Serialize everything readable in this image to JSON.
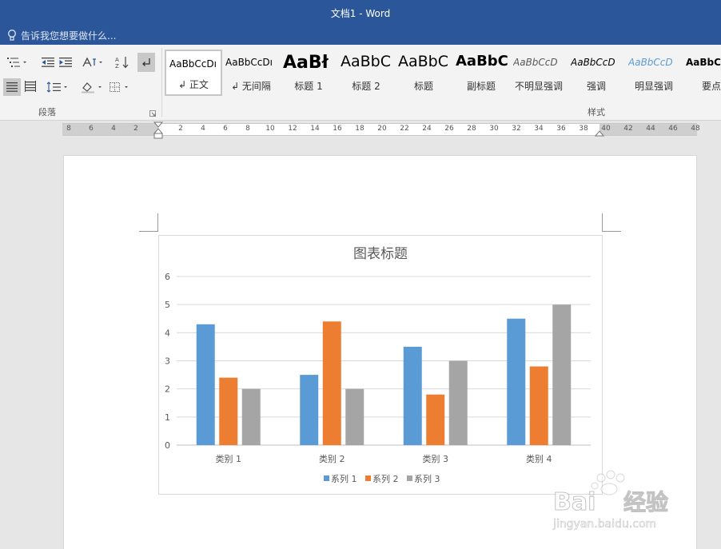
{
  "window": {
    "title": "文档1 - Word"
  },
  "tell_me": {
    "placeholder": "告诉我您想要做什么..."
  },
  "ribbon": {
    "paragraph_group_label": "段落",
    "styles_group_label": "样式",
    "styles": [
      {
        "sample": "AaBbCcDı",
        "name": "↲ 正文",
        "selected": true
      },
      {
        "sample": "AaBbCcDı",
        "name": "↲ 无间隔"
      },
      {
        "sample": "AaBł",
        "name": "标题 1"
      },
      {
        "sample": "AaBbC",
        "name": "标题 2"
      },
      {
        "sample": "AaBbC",
        "name": "标题"
      },
      {
        "sample": "AaBbC",
        "name": "副标题"
      },
      {
        "sample": "AaBbCcD",
        "name": "不明显强调"
      },
      {
        "sample": "AaBbCcD",
        "name": "强调"
      },
      {
        "sample": "AaBbCcD",
        "name": "明显强调"
      },
      {
        "sample": "AaBbC",
        "name": "要点"
      }
    ]
  },
  "ruler": {
    "labels": [
      "8",
      "6",
      "4",
      "2",
      "2",
      "4",
      "6",
      "8",
      "10",
      "12",
      "14",
      "16",
      "18",
      "20",
      "22",
      "24",
      "26",
      "28",
      "30",
      "32",
      "34",
      "36",
      "38",
      "40",
      "42",
      "44",
      "46",
      "48"
    ]
  },
  "chart_data": {
    "type": "bar",
    "title": "图表标题",
    "categories": [
      "类别 1",
      "类别 2",
      "类别 3",
      "类别 4"
    ],
    "series": [
      {
        "name": "系列 1",
        "values": [
          4.3,
          2.5,
          3.5,
          4.5
        ],
        "color": "#5b9bd5"
      },
      {
        "name": "系列 2",
        "values": [
          2.4,
          4.4,
          1.8,
          2.8
        ],
        "color": "#ed7d31"
      },
      {
        "name": "系列 3",
        "values": [
          2,
          2,
          3,
          5
        ],
        "color": "#a5a5a5"
      }
    ],
    "ylim": [
      0,
      6
    ],
    "yticks": [
      "0",
      "1",
      "2",
      "3",
      "4",
      "5",
      "6"
    ],
    "grid": true,
    "legend": "bottom"
  },
  "watermark": {
    "brand": "Baidu",
    "product": "经验",
    "url": "jingyan.baidu.com"
  }
}
